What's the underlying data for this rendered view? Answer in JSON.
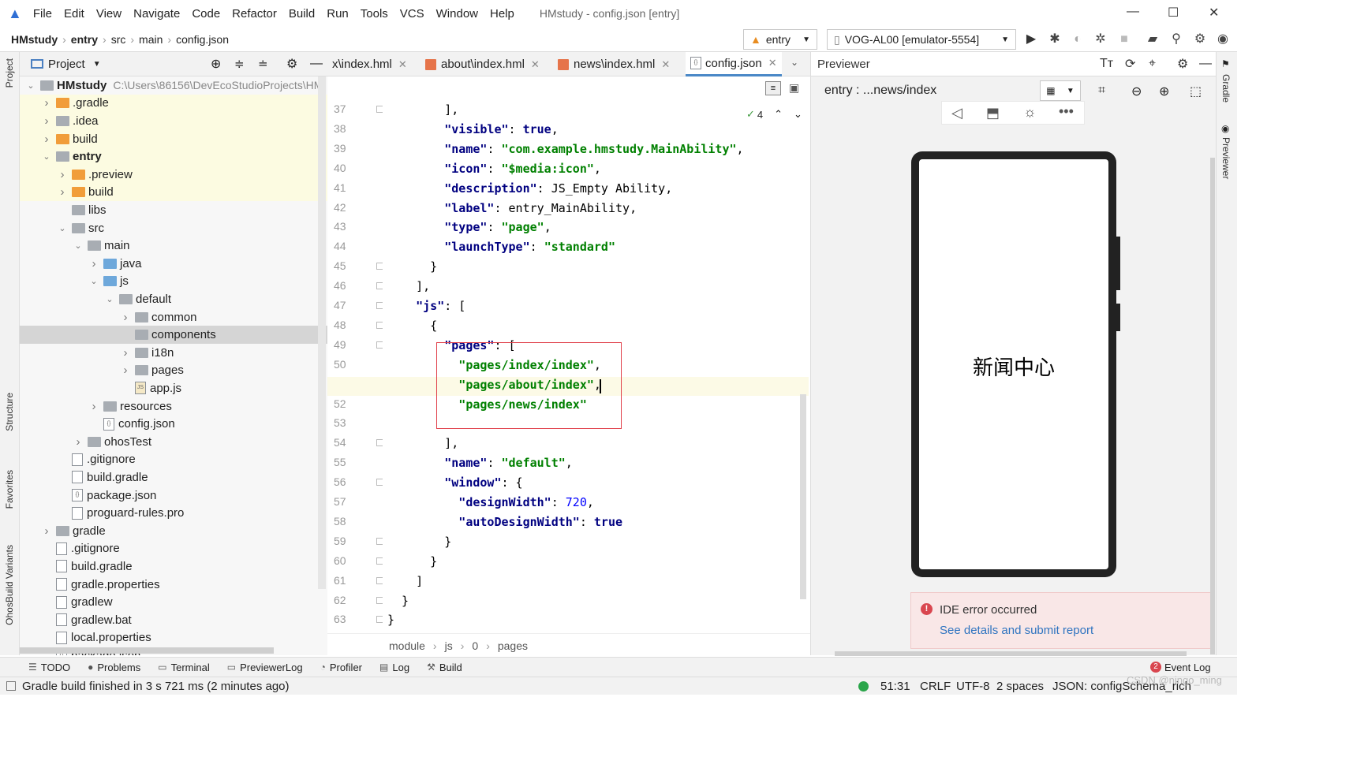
{
  "window": {
    "title": "HMstudy - config.json [entry]",
    "menu": [
      "File",
      "Edit",
      "View",
      "Navigate",
      "Code",
      "Refactor",
      "Build",
      "Run",
      "Tools",
      "VCS",
      "Window",
      "Help"
    ]
  },
  "nav": {
    "breadcrumb": [
      "HMstudy",
      "entry",
      "src",
      "main",
      "config.json"
    ],
    "module_selector": "entry",
    "device_selector": "VOG-AL00 [emulator-5554]"
  },
  "project_panel": {
    "title": "Project",
    "tree": [
      {
        "label": "HMstudy",
        "extra": "C:\\Users\\86156\\DevEcoStudioProjects\\HM",
        "depth": 0,
        "chev": "down",
        "icon": "folder-gray",
        "bold": true,
        "hl": ""
      },
      {
        "label": ".gradle",
        "depth": 1,
        "chev": "right",
        "icon": "folder-orange",
        "hl": "yel"
      },
      {
        "label": ".idea",
        "depth": 1,
        "chev": "right",
        "icon": "folder-gray",
        "hl": "yel"
      },
      {
        "label": "build",
        "depth": 1,
        "chev": "right",
        "icon": "folder-orange",
        "hl": "yel"
      },
      {
        "label": "entry",
        "depth": 1,
        "chev": "down",
        "icon": "folder-gray",
        "bold": true,
        "hl": "yel"
      },
      {
        "label": ".preview",
        "depth": 2,
        "chev": "right",
        "icon": "folder-orange",
        "hl": "yel"
      },
      {
        "label": "build",
        "depth": 2,
        "chev": "right",
        "icon": "folder-orange",
        "hl": "yel"
      },
      {
        "label": "libs",
        "depth": 2,
        "chev": "",
        "icon": "folder-gray",
        "hl": ""
      },
      {
        "label": "src",
        "depth": 2,
        "chev": "down",
        "icon": "folder-gray",
        "hl": ""
      },
      {
        "label": "main",
        "depth": 3,
        "chev": "down",
        "icon": "folder-gray",
        "hl": ""
      },
      {
        "label": "java",
        "depth": 4,
        "chev": "right",
        "icon": "folder-blue",
        "hl": ""
      },
      {
        "label": "js",
        "depth": 4,
        "chev": "down",
        "icon": "folder-blue",
        "hl": ""
      },
      {
        "label": "default",
        "depth": 5,
        "chev": "down",
        "icon": "folder-gray",
        "hl": ""
      },
      {
        "label": "common",
        "depth": 6,
        "chev": "right",
        "icon": "folder-gray",
        "hl": ""
      },
      {
        "label": "components",
        "depth": 6,
        "chev": "",
        "icon": "folder-gray",
        "hl": "sel"
      },
      {
        "label": "i18n",
        "depth": 6,
        "chev": "right",
        "icon": "folder-gray",
        "hl": ""
      },
      {
        "label": "pages",
        "depth": 6,
        "chev": "right",
        "icon": "folder-gray",
        "hl": ""
      },
      {
        "label": "app.js",
        "depth": 6,
        "chev": "",
        "icon": "file-js",
        "hl": ""
      },
      {
        "label": "resources",
        "depth": 4,
        "chev": "right",
        "icon": "folder-gray",
        "hl": ""
      },
      {
        "label": "config.json",
        "depth": 4,
        "chev": "",
        "icon": "file-json",
        "hl": ""
      },
      {
        "label": "ohosTest",
        "depth": 3,
        "chev": "right",
        "icon": "folder-gray",
        "hl": ""
      },
      {
        "label": ".gitignore",
        "depth": 2,
        "chev": "",
        "icon": "file",
        "hl": ""
      },
      {
        "label": "build.gradle",
        "depth": 2,
        "chev": "",
        "icon": "file",
        "hl": ""
      },
      {
        "label": "package.json",
        "depth": 2,
        "chev": "",
        "icon": "file-json",
        "hl": ""
      },
      {
        "label": "proguard-rules.pro",
        "depth": 2,
        "chev": "",
        "icon": "file",
        "hl": ""
      },
      {
        "label": "gradle",
        "depth": 1,
        "chev": "right",
        "icon": "folder-gray",
        "hl": ""
      },
      {
        "label": ".gitignore",
        "depth": 1,
        "chev": "",
        "icon": "file",
        "hl": ""
      },
      {
        "label": "build.gradle",
        "depth": 1,
        "chev": "",
        "icon": "file",
        "hl": ""
      },
      {
        "label": "gradle.properties",
        "depth": 1,
        "chev": "",
        "icon": "file",
        "hl": ""
      },
      {
        "label": "gradlew",
        "depth": 1,
        "chev": "",
        "icon": "file",
        "hl": ""
      },
      {
        "label": "gradlew.bat",
        "depth": 1,
        "chev": "",
        "icon": "file",
        "hl": ""
      },
      {
        "label": "local.properties",
        "depth": 1,
        "chev": "",
        "icon": "file",
        "hl": ""
      },
      {
        "label": "package.json",
        "depth": 1,
        "chev": "",
        "icon": "file-json",
        "hl": ""
      }
    ]
  },
  "side_labels": {
    "project": "Project",
    "structure": "Structure",
    "favorites": "Favorites",
    "build_variants": "OhosBuild Variants",
    "gradle": "Gradle",
    "previewer": "Previewer"
  },
  "editor": {
    "tabs": [
      {
        "label": "x\\index.hml",
        "icon": "html"
      },
      {
        "label": "about\\index.hml",
        "icon": "html"
      },
      {
        "label": "news\\index.hml",
        "icon": "html"
      },
      {
        "label": "config.json",
        "icon": "json",
        "active": true
      }
    ],
    "inspection_count": "4",
    "lines": [
      {
        "n": "37",
        "t": [
          [
            "p",
            "        ],"
          ]
        ]
      },
      {
        "n": "38",
        "t": [
          [
            "k",
            "        \"visible\""
          ],
          [
            "p",
            ": "
          ],
          [
            "k",
            "true"
          ],
          [
            "p",
            ","
          ]
        ]
      },
      {
        "n": "39",
        "t": [
          [
            "k",
            "        \"name\""
          ],
          [
            "p",
            ": "
          ],
          [
            "s",
            "\"com.example.hmstudy.MainAbility\""
          ],
          [
            "p",
            ","
          ]
        ]
      },
      {
        "n": "40",
        "t": [
          [
            "k",
            "        \"icon\""
          ],
          [
            "p",
            ": "
          ],
          [
            "s",
            "\"$media:icon\""
          ],
          [
            "p",
            ","
          ]
        ]
      },
      {
        "n": "41",
        "t": [
          [
            "k",
            "        \"description\""
          ],
          [
            "p",
            ": "
          ],
          [
            "p",
            "JS_Empty Ability"
          ],
          [
            "p",
            ","
          ]
        ]
      },
      {
        "n": "42",
        "t": [
          [
            "k",
            "        \"label\""
          ],
          [
            "p",
            ": "
          ],
          [
            "p",
            "entry_MainAbility"
          ],
          [
            "p",
            ","
          ]
        ]
      },
      {
        "n": "43",
        "t": [
          [
            "k",
            "        \"type\""
          ],
          [
            "p",
            ": "
          ],
          [
            "s",
            "\"page\""
          ],
          [
            "p",
            ","
          ]
        ]
      },
      {
        "n": "44",
        "t": [
          [
            "k",
            "        \"launchType\""
          ],
          [
            "p",
            ": "
          ],
          [
            "s",
            "\"standard\""
          ]
        ]
      },
      {
        "n": "45",
        "t": [
          [
            "p",
            "      }"
          ]
        ]
      },
      {
        "n": "46",
        "t": [
          [
            "p",
            "    ],"
          ]
        ]
      },
      {
        "n": "47",
        "t": [
          [
            "k",
            "    \"js\""
          ],
          [
            "p",
            ": ["
          ]
        ]
      },
      {
        "n": "48",
        "t": [
          [
            "p",
            "      {"
          ]
        ]
      },
      {
        "n": "49",
        "t": [
          [
            "k",
            "        \"pages\""
          ],
          [
            "p",
            ": ["
          ]
        ]
      },
      {
        "n": "50",
        "t": [
          [
            "s",
            "          \"pages/index/index\""
          ],
          [
            "p",
            ","
          ]
        ]
      },
      {
        "n": "51",
        "t": [
          [
            "s",
            "          \"pages/about/index\""
          ],
          [
            "p",
            ","
          ]
        ]
      },
      {
        "n": "52",
        "t": [
          [
            "s",
            "          \"pages/news/index\""
          ]
        ]
      },
      {
        "n": "53",
        "t": []
      },
      {
        "n": "54",
        "t": [
          [
            "p",
            "        ],"
          ]
        ]
      },
      {
        "n": "55",
        "t": [
          [
            "k",
            "        \"name\""
          ],
          [
            "p",
            ": "
          ],
          [
            "s",
            "\"default\""
          ],
          [
            "p",
            ","
          ]
        ]
      },
      {
        "n": "56",
        "t": [
          [
            "k",
            "        \"window\""
          ],
          [
            "p",
            ": {"
          ]
        ]
      },
      {
        "n": "57",
        "t": [
          [
            "k",
            "          \"designWidth\""
          ],
          [
            "p",
            ": "
          ],
          [
            "n",
            "720"
          ],
          [
            "p",
            ","
          ]
        ]
      },
      {
        "n": "58",
        "t": [
          [
            "k",
            "          \"autoDesignWidth\""
          ],
          [
            "p",
            ": "
          ],
          [
            "k",
            "true"
          ]
        ]
      },
      {
        "n": "59",
        "t": [
          [
            "p",
            "        }"
          ]
        ]
      },
      {
        "n": "60",
        "t": [
          [
            "p",
            "      }"
          ]
        ]
      },
      {
        "n": "61",
        "t": [
          [
            "p",
            "    ]"
          ]
        ]
      },
      {
        "n": "62",
        "t": [
          [
            "p",
            "  }"
          ]
        ]
      },
      {
        "n": "63",
        "t": [
          [
            "p",
            "}"
          ]
        ]
      }
    ],
    "breadcrumb": [
      "module",
      "js",
      "0",
      "pages"
    ]
  },
  "previewer": {
    "title": "Previewer",
    "path": "entry : ...news/index",
    "screen_text": "新闻中心",
    "error_title": "IDE error occurred",
    "error_link": "See details and submit report"
  },
  "bottom_tools": [
    "TODO",
    "Problems",
    "Terminal",
    "PreviewerLog",
    "Profiler",
    "Log",
    "Build"
  ],
  "event_log": {
    "label": "Event Log",
    "count": "2"
  },
  "status": {
    "message": "Gradle build finished in 3 s 721 ms (2 minutes ago)",
    "position": "51:31",
    "line_sep": "CRLF",
    "encoding": "UTF-8",
    "indent": "2 spaces",
    "schema": "JSON: configSchema_rich",
    "watermark": "CSDN @ningo_ming"
  },
  "colors": {
    "accent": "#4a88c7",
    "error": "#e0404a",
    "keyword": "#000080",
    "string": "#008000"
  }
}
